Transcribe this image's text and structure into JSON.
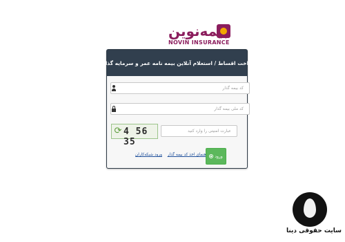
{
  "logo": {
    "brand": "بیمه‌نوین",
    "subtitle": "NOVIN INSURANCE"
  },
  "panel": {
    "title": "پرداخت اقساط / استعلام آنلاین بیمه نامه عمر و سرمایه گذاری",
    "fields": {
      "insurer_code_placeholder": "کد بیمه گذار",
      "national_id_placeholder": "کد ملی بیمه گذار",
      "captcha_placeholder": "عبارت امنیتی را وارد کنید"
    },
    "captcha": {
      "text": "4 56 35"
    },
    "links": {
      "get_code": "راهنمای اخذ کد بیمه گذار",
      "agent_login": "ورود شبکه‌کاران"
    },
    "login_label": "ورود"
  },
  "watermark": {
    "text": "سایت حقوقی دینا"
  }
}
